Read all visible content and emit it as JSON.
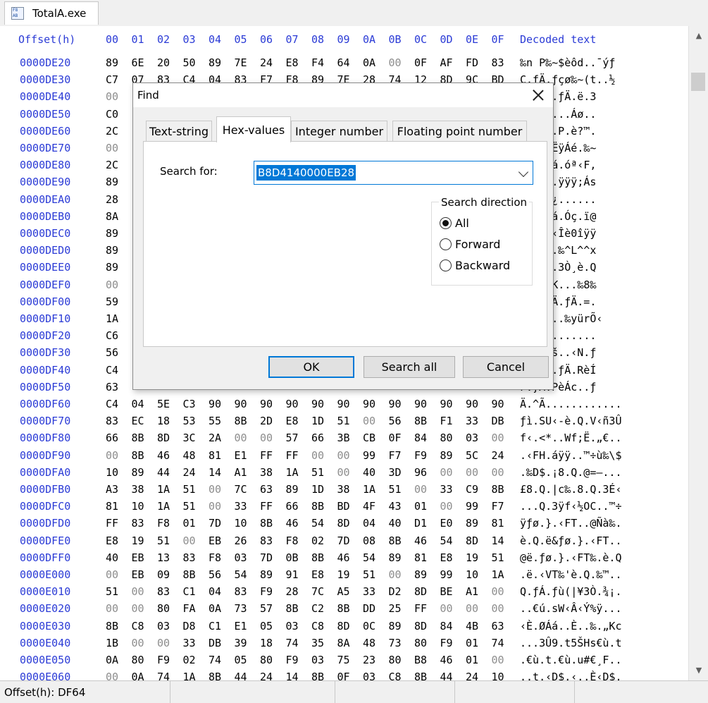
{
  "file_tab": {
    "title": "TotalA.exe",
    "icon": "hex-file-icon"
  },
  "hex_view": {
    "header": {
      "offset": "Offset(h)",
      "columns": [
        "00",
        "01",
        "02",
        "03",
        "04",
        "05",
        "06",
        "07",
        "08",
        "09",
        "0A",
        "0B",
        "0C",
        "0D",
        "0E",
        "0F"
      ],
      "decoded": "Decoded text"
    },
    "rows": [
      {
        "offset": "0000DE20",
        "bytes": [
          "89",
          "6E",
          "20",
          "50",
          "89",
          "7E",
          "24",
          "E8",
          "F4",
          "64",
          "0A",
          "00",
          "0F",
          "AF",
          "FD",
          "83"
        ],
        "text": "‰n P‰~$èôd..¯ýƒ"
      },
      {
        "offset": "0000DE30",
        "bytes": [
          "C7",
          "07",
          "83",
          "C4",
          "04",
          "83",
          "F7",
          "F8",
          "89",
          "7E",
          "28",
          "74",
          "12",
          "8D",
          "9C",
          "BD"
        ],
        "text": "Ç.ƒÄ.ƒçø‰~(t..½"
      },
      {
        "offset": "0000DE40",
        "bytes": [
          "00",
          "",
          "",
          "",
          "",
          "",
          "",
          "",
          "",
          "",
          "",
          "",
          "",
          "",
          "",
          ""
        ],
        "text": "QèÆd..ƒÄ.ë.3"
      },
      {
        "offset": "0000DE50",
        "bytes": [
          "C0",
          "",
          "",
          "",
          "",
          "",
          "",
          "",
          "",
          "",
          "",
          "",
          "",
          "",
          "",
          ""
        ],
        "text": "F(.ÿ...Áø.."
      },
      {
        "offset": "0000DE60",
        "bytes": [
          "2C",
          "",
          "",
          "",
          "",
          "",
          "",
          "",
          "",
          "",
          "",
          "",
          "",
          "",
          "",
          ""
        ],
        "text": "..Uh,.P.è?™."
      },
      {
        "offset": "0000DE70",
        "bytes": [
          "00",
          "",
          "",
          "",
          "",
          "",
          "",
          "",
          "",
          "",
          "",
          "",
          "",
          "",
          "",
          ""
        ],
        "text": "ø‹ÑƒËÿÁé.‰~"
      },
      {
        "offset": "0000DE80",
        "bytes": [
          "2C",
          "",
          "",
          "",
          "",
          "",
          "",
          "",
          "",
          "",
          "",
          "",
          "",
          "",
          "",
          ""
        ],
        "text": "Þ«Êƒá.óª‹F,"
      },
      {
        "offset": "0000DE90",
        "bytes": [
          "89",
          "",
          "",
          "",
          "",
          "",
          "",
          "",
          "",
          "",
          "",
          "",
          "",
          "",
          "",
          ""
        ],
        "text": "N(...ÿÿÿ;Ás"
      },
      {
        "offset": "0000DEA0",
        "bytes": [
          "28",
          "",
          "",
          "",
          "",
          "",
          "",
          "",
          "",
          "",
          "",
          "",
          "",
          "",
          "",
          ""
        ],
        "text": "ÈÁé.¿......"
      },
      {
        "offset": "0000DEB0",
        "bytes": [
          "8A",
          "",
          "",
          "",
          "",
          "",
          "",
          "",
          "",
          "",
          "",
          "",
          "",
          "",
          "",
          ""
        ],
        "text": "è.‹*ƒá.Óç.ï@"
      },
      {
        "offset": "0000DEC0",
        "bytes": [
          "89",
          "",
          "",
          "",
          "",
          "",
          "",
          "",
          "",
          "",
          "",
          "",
          "",
          "",
          "",
          ""
        ],
        "text": "(;ÄrØ‹Îè0îÿÿ"
      },
      {
        "offset": "0000DED0",
        "bytes": [
          "89",
          "",
          "",
          "",
          "",
          "",
          "",
          "",
          "",
          "",
          "",
          "",
          "",
          "",
          "",
          ""
        ],
        "text": "FH5...‰^L^^x"
      },
      {
        "offset": "0000DEE0",
        "bytes": [
          "89",
          "",
          "",
          "",
          "",
          "",
          "",
          "",
          "",
          "",
          "",
          "",
          "",
          "",
          "",
          ""
        ],
        "text": "FT.€..3Ò¸è.Q"
      },
      {
        "offset": "0000DEF0",
        "bytes": [
          "00",
          "",
          "",
          "",
          "",
          "",
          "",
          "",
          "",
          "",
          "",
          "",
          "",
          "",
          "",
          ""
        ],
        "text": "~T.ÂK...‰8‰"
      },
      {
        "offset": "0000DF00",
        "bytes": [
          "59",
          "",
          "",
          "",
          "",
          "",
          "",
          "",
          "",
          "",
          "",
          "",
          "",
          "",
          "",
          ""
        ],
        "text": "è.Q.ƒÄ.ƒÄ.=."
      },
      {
        "offset": "0000DF10",
        "bytes": [
          "1A",
          "",
          "",
          "",
          "",
          "",
          "",
          "",
          "",
          "",
          "",
          "",
          "",
          "",
          "",
          ""
        ],
        "text": "a......‰yürÕ‹"
      },
      {
        "offset": "0000DF20",
        "bytes": [
          "C6",
          "",
          "",
          "",
          "",
          "",
          "",
          "",
          "",
          "",
          "",
          "",
          "",
          "",
          "",
          ""
        ],
        "text": "[Ã........."
      },
      {
        "offset": "0000DF30",
        "bytes": [
          "56",
          "",
          "",
          "",
          "",
          "",
          "",
          "",
          "",
          "",
          "",
          "",
          "",
          "",
          "",
          ""
        ],
        "text": "F,Pèdš..‹N.ƒ"
      },
      {
        "offset": "0000DF40",
        "bytes": [
          "C4",
          "",
          "",
          "",
          "",
          "",
          "",
          "",
          "",
          "",
          "",
          "",
          "",
          "",
          "",
          ""
        ],
        "text": "ôc..‹.ƒÄ.RèÍ"
      },
      {
        "offset": "0000DF50",
        "bytes": [
          "63",
          "",
          "",
          "",
          "",
          "",
          "",
          "",
          "",
          "",
          "",
          "",
          "",
          "",
          "",
          ""
        ],
        "text": "F.ƒÄ.PèÁc..ƒ"
      },
      {
        "offset": "0000DF60",
        "bytes": [
          "C4",
          "04",
          "5E",
          "C3",
          "90",
          "90",
          "90",
          "90",
          "90",
          "90",
          "90",
          "90",
          "90",
          "90",
          "90",
          "90"
        ],
        "text": "Ä.^Ã............"
      },
      {
        "offset": "0000DF70",
        "bytes": [
          "83",
          "EC",
          "18",
          "53",
          "55",
          "8B",
          "2D",
          "E8",
          "1D",
          "51",
          "00",
          "56",
          "8B",
          "F1",
          "33",
          "DB"
        ],
        "text": "ƒì.SU‹-è.Q.V‹ñ3Û"
      },
      {
        "offset": "0000DF80",
        "bytes": [
          "66",
          "8B",
          "8D",
          "3C",
          "2A",
          "00",
          "00",
          "57",
          "66",
          "3B",
          "CB",
          "0F",
          "84",
          "80",
          "03",
          "00"
        ],
        "text": "f‹.<*..Wf;Ë.„€.."
      },
      {
        "offset": "0000DF90",
        "bytes": [
          "00",
          "8B",
          "46",
          "48",
          "81",
          "E1",
          "FF",
          "FF",
          "00",
          "00",
          "99",
          "F7",
          "F9",
          "89",
          "5C",
          "24"
        ],
        "text": ".‹FH.áÿÿ..™÷ù‰\\$"
      },
      {
        "offset": "0000DFA0",
        "bytes": [
          "10",
          "89",
          "44",
          "24",
          "14",
          "A1",
          "38",
          "1A",
          "51",
          "00",
          "40",
          "3D",
          "96",
          "00",
          "00",
          "00"
        ],
        "text": ".‰D$.¡8.Q.@=–..."
      },
      {
        "offset": "0000DFB0",
        "bytes": [
          "A3",
          "38",
          "1A",
          "51",
          "00",
          "7C",
          "63",
          "89",
          "1D",
          "38",
          "1A",
          "51",
          "00",
          "33",
          "C9",
          "8B"
        ],
        "text": "£8.Q.|c‰.8.Q.3É‹"
      },
      {
        "offset": "0000DFC0",
        "bytes": [
          "81",
          "10",
          "1A",
          "51",
          "00",
          "33",
          "FF",
          "66",
          "8B",
          "BD",
          "4F",
          "43",
          "01",
          "00",
          "99",
          "F7"
        ],
        "text": "...Q.3ÿf‹½OC..™÷"
      },
      {
        "offset": "0000DFD0",
        "bytes": [
          "FF",
          "83",
          "F8",
          "01",
          "7D",
          "10",
          "8B",
          "46",
          "54",
          "8D",
          "04",
          "40",
          "D1",
          "E0",
          "89",
          "81"
        ],
        "text": "ÿƒø.}.‹FT..@Ñà‰."
      },
      {
        "offset": "0000DFE0",
        "bytes": [
          "E8",
          "19",
          "51",
          "00",
          "EB",
          "26",
          "83",
          "F8",
          "02",
          "7D",
          "08",
          "8B",
          "46",
          "54",
          "8D",
          "14"
        ],
        "text": "è.Q.ë&ƒø.}.‹FT.."
      },
      {
        "offset": "0000DFF0",
        "bytes": [
          "40",
          "EB",
          "13",
          "83",
          "F8",
          "03",
          "7D",
          "0B",
          "8B",
          "46",
          "54",
          "89",
          "81",
          "E8",
          "19",
          "51"
        ],
        "text": "@ë.ƒø.}.‹FT‰.è.Q"
      },
      {
        "offset": "0000E000",
        "bytes": [
          "00",
          "EB",
          "09",
          "8B",
          "56",
          "54",
          "89",
          "91",
          "E8",
          "19",
          "51",
          "00",
          "89",
          "99",
          "10",
          "1A"
        ],
        "text": ".ë.‹VT‰'è.Q.‰™.."
      },
      {
        "offset": "0000E010",
        "bytes": [
          "51",
          "00",
          "83",
          "C1",
          "04",
          "83",
          "F9",
          "28",
          "7C",
          "A5",
          "33",
          "D2",
          "8D",
          "BE",
          "A1",
          "00"
        ],
        "text": "Q.ƒÁ.ƒù(|¥3Ò.¾¡."
      },
      {
        "offset": "0000E020",
        "bytes": [
          "00",
          "00",
          "80",
          "FA",
          "0A",
          "73",
          "57",
          "8B",
          "C2",
          "8B",
          "DD",
          "25",
          "FF",
          "00",
          "00",
          "00"
        ],
        "text": "..€ú.sW‹Â‹Ý%ÿ..."
      },
      {
        "offset": "0000E030",
        "bytes": [
          "8B",
          "C8",
          "03",
          "D8",
          "C1",
          "E1",
          "05",
          "03",
          "C8",
          "8D",
          "0C",
          "89",
          "8D",
          "84",
          "4B",
          "63"
        ],
        "text": "‹È.ØÁá..È..‰.„Kc"
      },
      {
        "offset": "0000E040",
        "bytes": [
          "1B",
          "00",
          "00",
          "33",
          "DB",
          "39",
          "18",
          "74",
          "35",
          "8A",
          "48",
          "73",
          "80",
          "F9",
          "01",
          "74"
        ],
        "text": "...3Û9.t5ŠHs€ù.t"
      },
      {
        "offset": "0000E050",
        "bytes": [
          "0A",
          "80",
          "F9",
          "02",
          "74",
          "05",
          "80",
          "F9",
          "03",
          "75",
          "23",
          "80",
          "B8",
          "46",
          "01",
          "00"
        ],
        "text": ".€ù.t.€ù.u#€¸F.."
      },
      {
        "offset": "0000E060",
        "bytes": [
          "00",
          "0A",
          "74",
          "1A",
          "8B",
          "44",
          "24",
          "14",
          "8B",
          "0F",
          "03",
          "C8",
          "8B",
          "44",
          "24",
          "10"
        ],
        "text": "..t.‹D$.‹..È‹D$."
      }
    ]
  },
  "status": {
    "offset_text": "Offset(h): DF64"
  },
  "find_dialog": {
    "title": "Find",
    "tabs": [
      "Text-string",
      "Hex-values",
      "Integer number",
      "Floating point number"
    ],
    "active_tab": "Hex-values",
    "search_label": "Search for:",
    "search_value": "B8D4140000EB28",
    "direction": {
      "legend": "Search direction",
      "options": [
        "All",
        "Forward",
        "Backward"
      ],
      "selected": "All"
    },
    "buttons": {
      "ok": "OK",
      "search_all": "Search all",
      "cancel": "Cancel"
    }
  },
  "colors": {
    "offset_blue": "#2b3bd6",
    "zero_byte_gray": "#8d8d8d",
    "selection_blue": "#0078d7"
  }
}
